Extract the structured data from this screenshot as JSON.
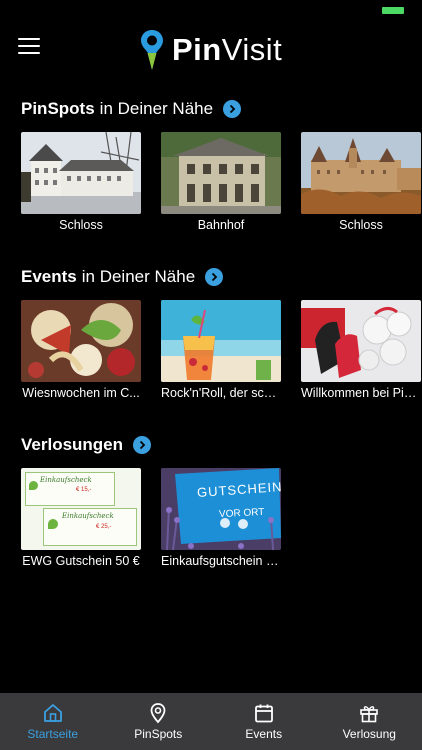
{
  "header": {
    "logo_bold": "Pin",
    "logo_light": "Visit"
  },
  "colors": {
    "accent": "#3aa0e0",
    "logo_pin_blue": "#2b9be0",
    "logo_pin_green": "#8cc63f",
    "tabbar": "#3a3a3c"
  },
  "sections": [
    {
      "title_bold": "PinSpots",
      "title_rest": "in Deiner Nähe",
      "items": [
        {
          "caption": "Schloss"
        },
        {
          "caption": "Bahnhof"
        },
        {
          "caption": "Schloss"
        }
      ]
    },
    {
      "title_bold": "Events",
      "title_rest": "in Deiner Nähe",
      "items": [
        {
          "caption": "Wiesnwochen im C..."
        },
        {
          "caption": "Rock'n'Roll, der sch..."
        },
        {
          "caption": "Willkommen bei Pin..."
        }
      ]
    },
    {
      "title_bold": "Verlosungen",
      "title_rest": "",
      "items": [
        {
          "caption": "EWG Gutschein 50 €",
          "voucher_title": "Einkaufscheck",
          "voucher_amount_1": "€ 15,-",
          "voucher_amount_2": "€ 25,-"
        },
        {
          "caption": "Einkaufsgutschein 1...",
          "sign_text": "GUTSCHEIN",
          "sign_sub": "VOR ORT"
        }
      ]
    }
  ],
  "tabbar": {
    "tabs": [
      {
        "label": "Startseite",
        "icon": "home-icon",
        "active": true
      },
      {
        "label": "PinSpots",
        "icon": "map-pin-icon",
        "active": false
      },
      {
        "label": "Events",
        "icon": "calendar-icon",
        "active": false
      },
      {
        "label": "Verlosung",
        "icon": "gift-icon",
        "active": false
      }
    ]
  }
}
